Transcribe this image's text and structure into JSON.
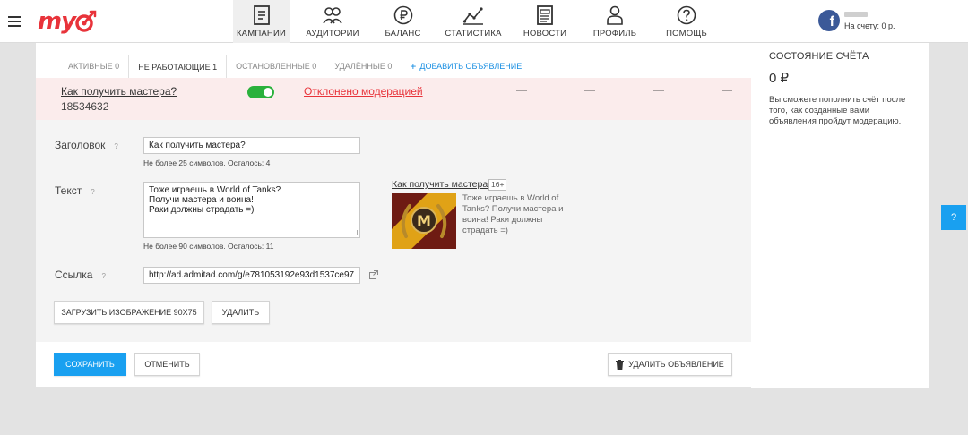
{
  "header": {
    "logo_text": "my",
    "nav": [
      {
        "label": "КАМПАНИИ",
        "icon": "campaigns-icon",
        "active": true
      },
      {
        "label": "АУДИТОРИИ",
        "icon": "audiences-icon",
        "active": false
      },
      {
        "label": "БАЛАНС",
        "icon": "ruble-icon",
        "active": false
      },
      {
        "label": "СТАТИСТИКА",
        "icon": "statistics-icon",
        "active": false
      },
      {
        "label": "НОВОСТИ",
        "icon": "news-icon",
        "active": false
      },
      {
        "label": "ПРОФИЛЬ",
        "icon": "profile-icon",
        "active": false
      },
      {
        "label": "ПОМОЩЬ",
        "icon": "help-icon",
        "active": false
      }
    ],
    "account": {
      "network_letter": "f",
      "balance_text": "На счету: 0 р."
    }
  },
  "tabs": {
    "active": "АКТИВНЫЕ 0",
    "inactive": "НЕ РАБОТАЮЩИЕ 1",
    "stopped": "ОСТАНОВЛЕННЫЕ 0",
    "deleted": "УДАЛЁННЫЕ 0",
    "add": "ДОБАВИТЬ ОБЪЯВЛЕНИЕ",
    "add_symbol": "+"
  },
  "ad": {
    "title": "Как получить мастера?",
    "id": "18534632",
    "enabled": true,
    "status": "Отклонено модерацией",
    "dash": "—"
  },
  "form": {
    "headline_label": "Заголовок",
    "headline_value": "Как получить мастера?",
    "headline_hint": "Не более 25 символов. Осталось: 4",
    "text_label": "Текст",
    "text_lines": [
      "Тоже играешь в World of Tanks?",
      "Получи мастера и воина!",
      "Раки должны страдать =)"
    ],
    "text_hint": "Не более 90 символов. Осталось: 11",
    "link_label": "Ссылка",
    "link_value": "http://ad.admitad.com/g/e781053192e93d1537ce97",
    "help_mark": "?",
    "upload_button": "ЗАГРУЗИТЬ ИЗОБРАЖЕНИЕ 90X75",
    "remove_button": "УДАЛИТЬ"
  },
  "preview": {
    "title": "Как получить мастера?",
    "age": "16+",
    "text": "Тоже играешь в World of Tanks? Получи мастера и воина! Раки должны страдать =)",
    "badge_letter": "M"
  },
  "footer": {
    "save": "СОХРАНИТЬ",
    "cancel": "ОТМЕНИТЬ",
    "delete_ad": "УДАЛИТЬ ОБЪЯВЛЕНИЕ"
  },
  "sidebar": {
    "title": "СОСТОЯНИЕ СЧЁТА",
    "balance": "0 ₽",
    "text": "Вы сможете пополнить счёт после того, как созданные вами объявления пройдут модерацию."
  },
  "help_tab": "?",
  "colors": {
    "brand": "#e8333a",
    "accent": "#19a0f0",
    "toggle_on": "#2ab13c",
    "rejected_row": "#fbecec"
  }
}
